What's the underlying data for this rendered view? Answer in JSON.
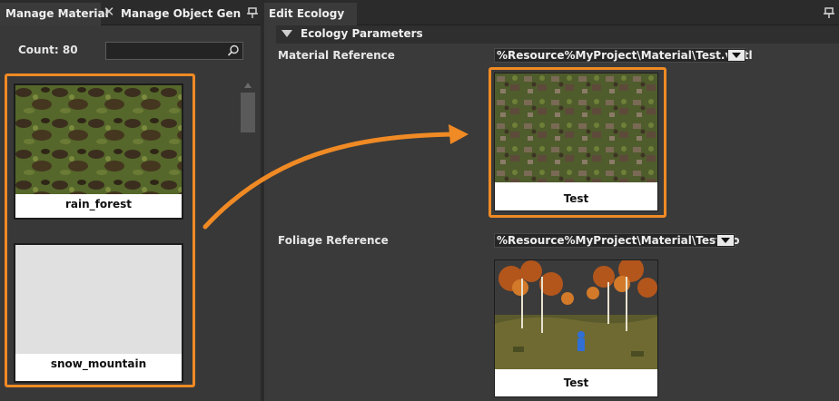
{
  "left_tabs": [
    {
      "label": "Manage Material"
    },
    {
      "label": "Manage Object Gen"
    }
  ],
  "right_tabs": [
    {
      "label": "Edit Ecology"
    }
  ],
  "icons": {
    "tab_close": "close-icon",
    "tab_pin": "pin-icon",
    "search": "search-icon",
    "dropdown": "chevron-down-icon",
    "section_toggle": "triangle-down-icon"
  },
  "material_panel": {
    "count_label": "Count: 80",
    "search": {
      "value": "",
      "placeholder": ""
    },
    "materials": [
      {
        "name": "rain_forest"
      },
      {
        "name": "snow_mountain"
      }
    ]
  },
  "ecology": {
    "section_title": "Ecology Parameters",
    "material_reference": {
      "label": "Material Reference",
      "path": "%Resource%MyProject\\Material\\Test.vmtl",
      "preview_name": "Test"
    },
    "foliage_reference": {
      "label": "Foliage Reference",
      "path": "%Resource%MyProject\\Material\\Test.vo",
      "preview_name": "Test"
    }
  },
  "colors": {
    "highlight": "#f08a24",
    "panel_bg": "#3a3a3a",
    "tabbar_bg": "#2b2b2b"
  }
}
